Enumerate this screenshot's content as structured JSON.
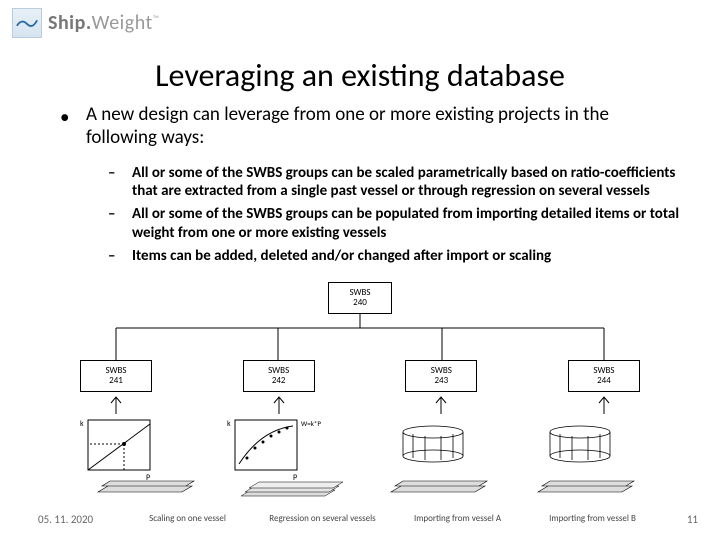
{
  "logo": {
    "word1": "Ship.",
    "word2": "Weight",
    "tm": "™"
  },
  "title": "Leveraging an existing database",
  "bullet": "A new design can leverage from one or more existing projects in the following ways:",
  "subs": [
    "All or some of the SWBS groups can be scaled parametrically based on ratio-coefficients that are extracted from a single past vessel or through regression on several vessels",
    "All or some of the SWBS groups can be populated from importing detailed items or total weight from one or more existing vessels",
    "Items can be added, deleted and/or changed after import or scaling"
  ],
  "diagram": {
    "top": {
      "label1": "SWBS",
      "label2": "240"
    },
    "mids": [
      {
        "label1": "SWBS",
        "label2": "241"
      },
      {
        "label1": "SWBS",
        "label2": "242"
      },
      {
        "label1": "SWBS",
        "label2": "243"
      },
      {
        "label1": "SWBS",
        "label2": "244"
      }
    ],
    "captions": [
      "Scaling on one vessel",
      "Regression on several vessels",
      "Importing from vessel A",
      "Importing from vessel B"
    ],
    "axis": {
      "k": "k",
      "p": "P",
      "w": "W=k*P"
    }
  },
  "footer": {
    "date": "05. 11. 2020",
    "page": "11"
  }
}
